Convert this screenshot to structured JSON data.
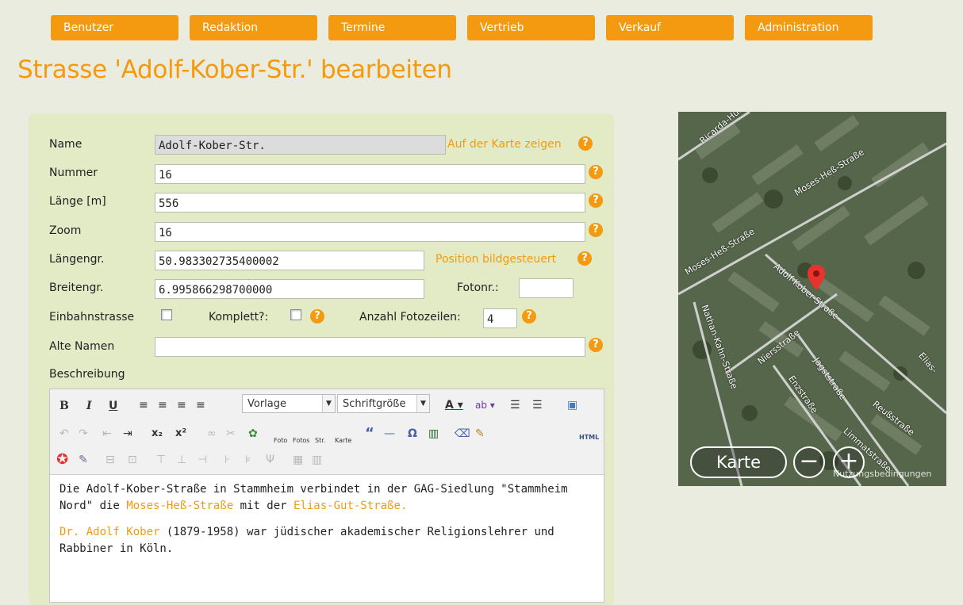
{
  "nav": [
    "Benutzer",
    "Redaktion",
    "Termine",
    "Vertrieb",
    "Verkauf",
    "Administration"
  ],
  "page_title": "Strasse 'Adolf-Kober-Str.' bearbeiten",
  "form": {
    "name_label": "Name",
    "name_value": "Adolf-Kober-Str.",
    "show_on_map": "Auf der Karte zeigen",
    "nummer_label": "Nummer",
    "nummer_value": "16",
    "laenge_label": "Länge [m]",
    "laenge_value": "556",
    "zoom_label": "Zoom",
    "zoom_value": "16",
    "laengengr_label": "Längengr.",
    "laengengr_value": "50.983302735400002",
    "position_link": "Position bildgesteuert",
    "breitengr_label": "Breitengr.",
    "breitengr_value": "6.995866298700000",
    "fotonr_label": "Fotonr.:",
    "fotonr_value": "",
    "einbahn_label": "Einbahnstrasse",
    "komplett_label": "Komplett?:",
    "fotozeilen_label": "Anzahl Fotozeilen:",
    "fotozeilen_value": "4",
    "alte_namen_label": "Alte Namen",
    "alte_namen_value": "",
    "beschreibung_label": "Beschreibung",
    "help": "?"
  },
  "editor": {
    "bold": "B",
    "italic": "I",
    "underline": "U",
    "format_select": "Vorlage",
    "size_select": "Schriftgröße",
    "subscript": "x₂",
    "superscript": "x²",
    "foto": "Foto",
    "fotos": "Fotos",
    "str": "Str.",
    "karte": "Karte",
    "quote": "“",
    "hr": "—",
    "omega": "Ω",
    "html": "HTML",
    "p1_a": "Die Adolf-Kober-Straße in Stammheim verbindet in der GAG-Siedlung \"Stammheim Nord\" die ",
    "p1_link1": "Moses-Heß-Straße",
    "p1_b": " mit der ",
    "p1_link2": "Elias-Gut-Straße.",
    "p2_link": "Dr. Adolf Kober",
    "p2_rest": " (1879-1958) war jüdischer akademischer Religionslehrer und Rabbiner in Köln."
  },
  "map": {
    "type_button": "Karte",
    "zoom_out": "−",
    "zoom_in": "+",
    "terms": "Nutzungsbedingungen",
    "streets": [
      "Ricarda-Huch",
      "Moses-Heß-Straße",
      "Moses-Heß-Straße",
      "Adolf-Kober-Straße",
      "Nathan-Kahn-Straße",
      "Niersstraße",
      "Jagststraße",
      "Enzstraße",
      "Reußstraße",
      "Elias-",
      "Limmatstraße"
    ]
  }
}
